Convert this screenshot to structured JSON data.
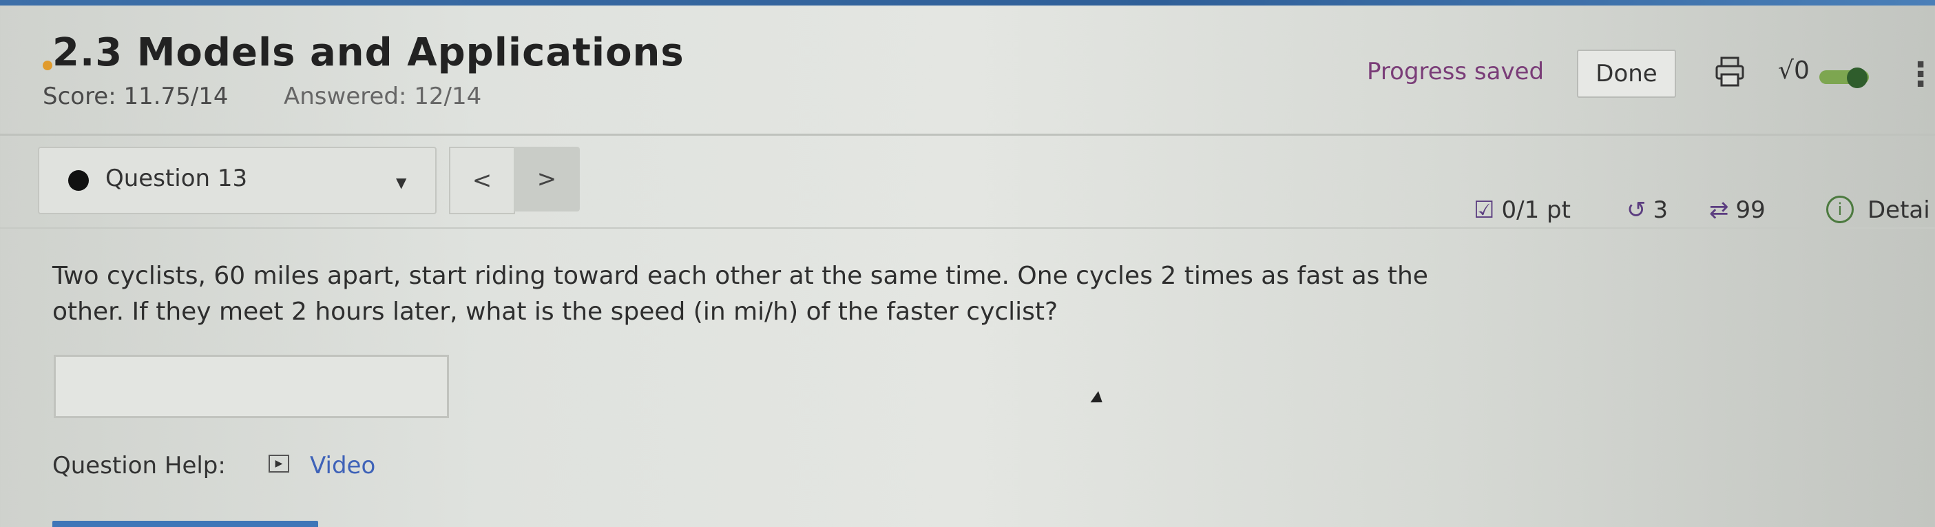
{
  "header": {
    "title": "2.3 Models and Applications",
    "score": "Score: 11.75/14",
    "answered": "Answered: 12/14",
    "progress_status": "Progress saved",
    "done_label": "Done",
    "sqrt_symbol": "√0",
    "more_symbol": "⋮"
  },
  "question_nav": {
    "selected": "Question 13",
    "prev": "<",
    "next": ">"
  },
  "question_meta": {
    "points": "0/1 pt",
    "retries": "3",
    "attempts": "99",
    "details": "Detai"
  },
  "question": {
    "text": "Two cyclists, 60 miles apart, start riding toward each other at the same time. One cycles 2 times as fast as the other. If they meet 2 hours later, what is the speed (in mi/h) of the faster cyclist?",
    "answer_value": ""
  },
  "help": {
    "label": "Question Help:",
    "video_label": "Video"
  },
  "colors": {
    "top_bar": "#2f5f98",
    "progress_text": "#7a3d78",
    "toggle_on": "#7da650",
    "link": "#3e62b8"
  },
  "icons": [
    "print-icon",
    "sqrt-toggle-icon",
    "more-icon",
    "checkbox-icon",
    "retry-icon",
    "attempts-icon",
    "info-icon",
    "video-icon"
  ]
}
